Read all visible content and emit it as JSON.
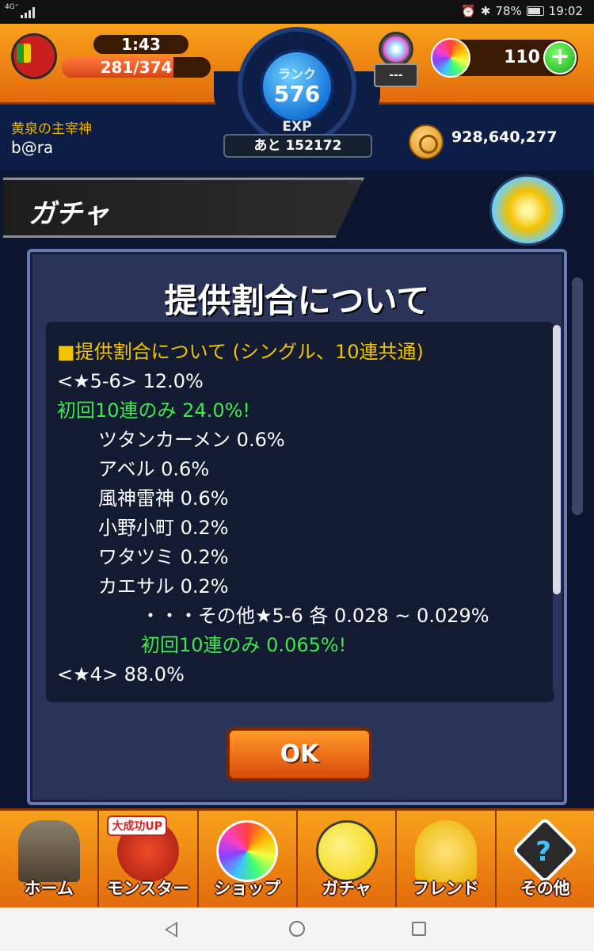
{
  "status_bar": {
    "network": "4G⁺",
    "battery_percent": "78%",
    "battery_level": 0.78,
    "time": "19:02"
  },
  "header": {
    "stamina_timer": "1:43",
    "stamina_value": "281/374",
    "stamina_fraction": 0.751,
    "rank_label": "ランク",
    "rank_value": "576",
    "exp_label": "EXP",
    "exp_remaining": "あと 152172",
    "machine_label": "---",
    "orb_count": "110",
    "plus_label": "+",
    "player_title": "黄泉の主宰神",
    "username": "b@ra",
    "gold": "928,640,277"
  },
  "page": {
    "title": "ガチャ"
  },
  "dialog": {
    "title": "提供割合について",
    "lines": [
      {
        "text": "■提供割合について (シングル、10連共通)"
      },
      {
        "text": "<★5-6> 12.0%"
      },
      {
        "text": "初回10連のみ 24.0%!"
      },
      {
        "text": "ツタンカーメン 0.6%"
      },
      {
        "text": "アベル 0.6%"
      },
      {
        "text": "風神雷神 0.6%"
      },
      {
        "text": "小野小町 0.2%"
      },
      {
        "text": "ワタツミ 0.2%"
      },
      {
        "text": "カエサル 0.2%"
      },
      {
        "text": "・・・その他★5-6 各 0.028 ~ 0.029%"
      },
      {
        "text": "初回10連のみ 0.065%!"
      },
      {
        "text": "<★4> 88.0%"
      }
    ],
    "ok_label": "OK"
  },
  "bottom_nav": {
    "items": [
      {
        "label": "ホーム",
        "icon": "home-icon"
      },
      {
        "label": "モンスター",
        "icon": "monster-icon",
        "badge": "大成功UP"
      },
      {
        "label": "ショップ",
        "icon": "shop-icon"
      },
      {
        "label": "ガチャ",
        "icon": "gacha-icon"
      },
      {
        "label": "フレンド",
        "icon": "friend-icon"
      },
      {
        "label": "その他",
        "icon": "other-icon"
      }
    ],
    "other_glyph": "?"
  },
  "colors": {
    "accent_orange": "#f7a21c",
    "heading_yellow": "#f2c400",
    "bonus_green": "#3fe84a",
    "dialog_bg": "#2a3458"
  }
}
